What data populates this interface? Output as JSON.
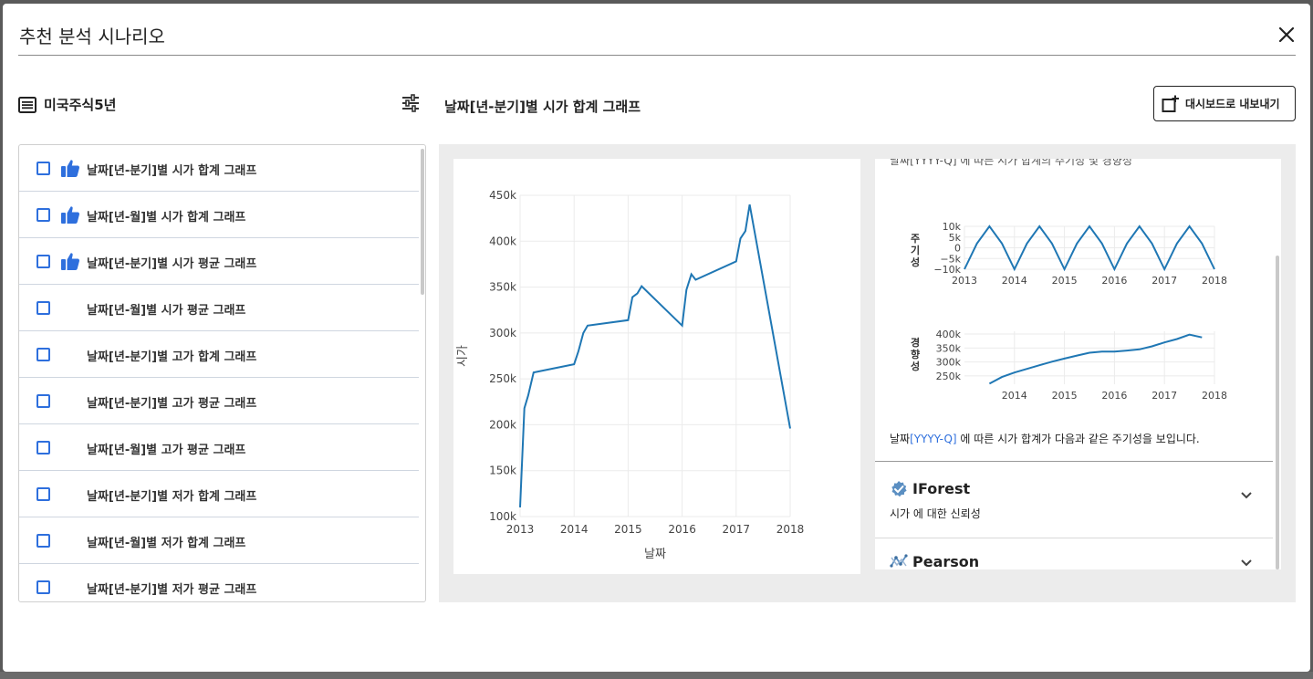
{
  "modal": {
    "title": "추천 분석 시나리오"
  },
  "left_panel": {
    "dataset_label": "미국주식5년",
    "dataset_icon": "table-list-icon",
    "filter_icon": "sliders-icon",
    "items": [
      {
        "label": "날짜[년-분기]별 시가 합계 그래프",
        "recommended": true,
        "checked": false
      },
      {
        "label": "날짜[년-월]별 시가 합계 그래프",
        "recommended": true,
        "checked": false
      },
      {
        "label": "날짜[년-분기]별 시가 평균 그래프",
        "recommended": true,
        "checked": false
      },
      {
        "label": "날짜[년-월]별 시가 평균 그래프",
        "recommended": false,
        "checked": false
      },
      {
        "label": "날짜[년-분기]별 고가 합계 그래프",
        "recommended": false,
        "checked": false
      },
      {
        "label": "날짜[년-분기]별 고가 평균 그래프",
        "recommended": false,
        "checked": false
      },
      {
        "label": "날짜[년-월]별 고가 평균 그래프",
        "recommended": false,
        "checked": false
      },
      {
        "label": "날짜[년-분기]별 저가 합계 그래프",
        "recommended": false,
        "checked": false
      },
      {
        "label": "날짜[년-월]별 저가 합계 그래프",
        "recommended": false,
        "checked": false
      },
      {
        "label": "날짜[년-분기]별 저가 평균 그래프",
        "recommended": false,
        "checked": false
      }
    ]
  },
  "chart_panel": {
    "heading": "날짜[년-분기]별 시가 합계 그래프",
    "export_label": "대시보드로 내보내기",
    "export_icon": "add-to-dashboard-icon"
  },
  "chart_data": [
    {
      "type": "line",
      "xlabel": "날짜",
      "ylabel": "시가",
      "xlim": [
        2013,
        2018
      ],
      "ylim": [
        100000,
        450000
      ],
      "x_ticks": [
        "2013",
        "2014",
        "2015",
        "2016",
        "2017",
        "2018"
      ],
      "y_ticks": [
        "100k",
        "150k",
        "200k",
        "250k",
        "300k",
        "350k",
        "400k",
        "450k"
      ],
      "color": "#1f77b4",
      "points": [
        [
          2013.0,
          110000
        ],
        [
          2013.08,
          218000
        ],
        [
          2013.15,
          232000
        ],
        [
          2013.25,
          257000
        ],
        [
          2014.0,
          266000
        ],
        [
          2014.08,
          280000
        ],
        [
          2014.17,
          300000
        ],
        [
          2014.25,
          308000
        ],
        [
          2015.0,
          314000
        ],
        [
          2015.08,
          339000
        ],
        [
          2015.17,
          343000
        ],
        [
          2015.25,
          351000
        ],
        [
          2016.0,
          308000
        ],
        [
          2016.08,
          347000
        ],
        [
          2016.17,
          364000
        ],
        [
          2016.25,
          358000
        ],
        [
          2017.0,
          378000
        ],
        [
          2017.08,
          403000
        ],
        [
          2017.17,
          411000
        ],
        [
          2017.25,
          440000
        ],
        [
          2018.0,
          196000
        ]
      ]
    },
    {
      "type": "line",
      "title": "",
      "ylabel": "주기성",
      "xlim": [
        2013,
        2018
      ],
      "ylim": [
        -10000,
        10000
      ],
      "x_ticks": [
        "2013",
        "2014",
        "2015",
        "2016",
        "2017",
        "2018"
      ],
      "y_ticks": [
        "10k",
        "5k",
        "0",
        "−5k",
        "−10k"
      ],
      "color": "#1f77b4",
      "points": [
        [
          2013.0,
          -10000
        ],
        [
          2013.25,
          2000
        ],
        [
          2013.5,
          10000
        ],
        [
          2013.75,
          2000
        ],
        [
          2014.0,
          -10000
        ],
        [
          2014.25,
          2000
        ],
        [
          2014.5,
          10000
        ],
        [
          2014.75,
          2000
        ],
        [
          2015.0,
          -10000
        ],
        [
          2015.25,
          2000
        ],
        [
          2015.5,
          10000
        ],
        [
          2015.75,
          2000
        ],
        [
          2016.0,
          -10000
        ],
        [
          2016.25,
          2000
        ],
        [
          2016.5,
          10000
        ],
        [
          2016.75,
          2000
        ],
        [
          2017.0,
          -10000
        ],
        [
          2017.25,
          2000
        ],
        [
          2017.5,
          10000
        ],
        [
          2017.75,
          2000
        ],
        [
          2018.0,
          -10000
        ]
      ]
    },
    {
      "type": "line",
      "ylabel": "경향성",
      "xlim": [
        2013,
        2018
      ],
      "ylim": [
        220000,
        410000
      ],
      "x_ticks": [
        "2014",
        "2015",
        "2016",
        "2017",
        "2018"
      ],
      "y_ticks": [
        "400k",
        "350k",
        "300k",
        "250k"
      ],
      "color": "#1f77b4",
      "points": [
        [
          2013.5,
          222000
        ],
        [
          2013.75,
          246000
        ],
        [
          2014.0,
          262000
        ],
        [
          2014.25,
          275000
        ],
        [
          2014.5,
          288000
        ],
        [
          2014.75,
          301000
        ],
        [
          2015.0,
          312000
        ],
        [
          2015.25,
          323000
        ],
        [
          2015.5,
          333000
        ],
        [
          2015.75,
          337000
        ],
        [
          2016.0,
          337000
        ],
        [
          2016.25,
          341000
        ],
        [
          2016.5,
          345000
        ],
        [
          2016.75,
          356000
        ],
        [
          2017.0,
          370000
        ],
        [
          2017.25,
          382000
        ],
        [
          2017.5,
          398000
        ],
        [
          2017.75,
          388000
        ]
      ]
    }
  ],
  "side_panel": {
    "clipped_text": "날짜[YYYY-Q] 에 따른 시가 합계의 주기성 및 경향성",
    "period_prefix": "날짜",
    "period_highlight": "[YYYY-Q]",
    "period_suffix": " 에 따른 시가 합계가 다음과 같은 주기성을 보입니다.",
    "accordions": [
      {
        "title": "IForest",
        "subtitle": "시가 에 대한 신뢰성",
        "icon": "iforest-badge-icon"
      },
      {
        "title": "Pearson",
        "subtitle": "",
        "icon": "pearson-network-icon"
      }
    ]
  }
}
